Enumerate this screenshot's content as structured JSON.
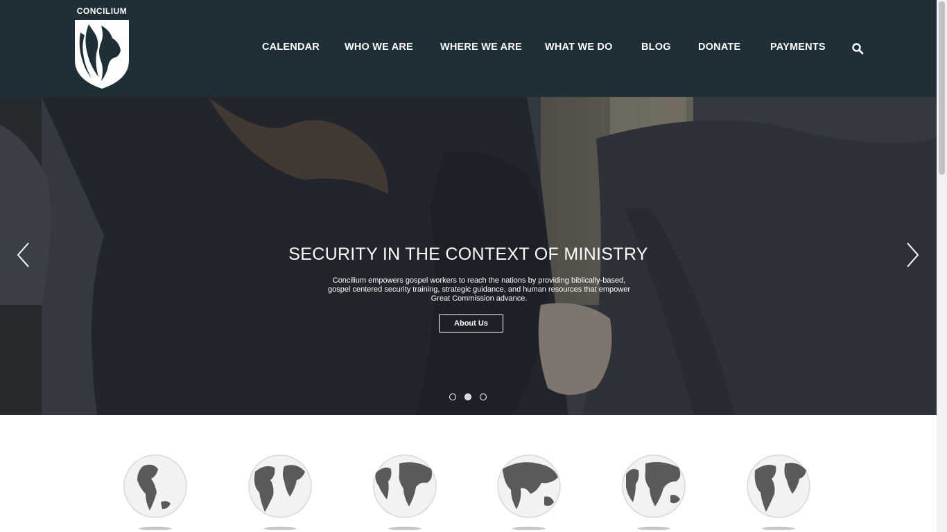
{
  "brand": {
    "name": "CONCILIUM"
  },
  "nav": {
    "items": [
      {
        "label": "CALENDAR"
      },
      {
        "label": "WHO WE ARE"
      },
      {
        "label": "WHERE WE ARE"
      },
      {
        "label": "WHAT WE DO"
      },
      {
        "label": "BLOG"
      },
      {
        "label": "DONATE"
      },
      {
        "label": "PAYMENTS"
      }
    ],
    "search_icon": "search-icon"
  },
  "hero": {
    "title": "SECURITY IN THE CONTEXT OF MINISTRY",
    "description": "Concilium empowers gospel workers to reach the nations by providing biblically-based, gospel centered security training, strategic guidance, and human resources that empower Great Commission advance.",
    "button_label": "About Us",
    "slide_count": 3,
    "active_slide": 2
  },
  "globes": {
    "count": 6,
    "icon": "globe-icon"
  },
  "colors": {
    "header_bg": "#1e2f38",
    "text_light": "#ffffff"
  }
}
